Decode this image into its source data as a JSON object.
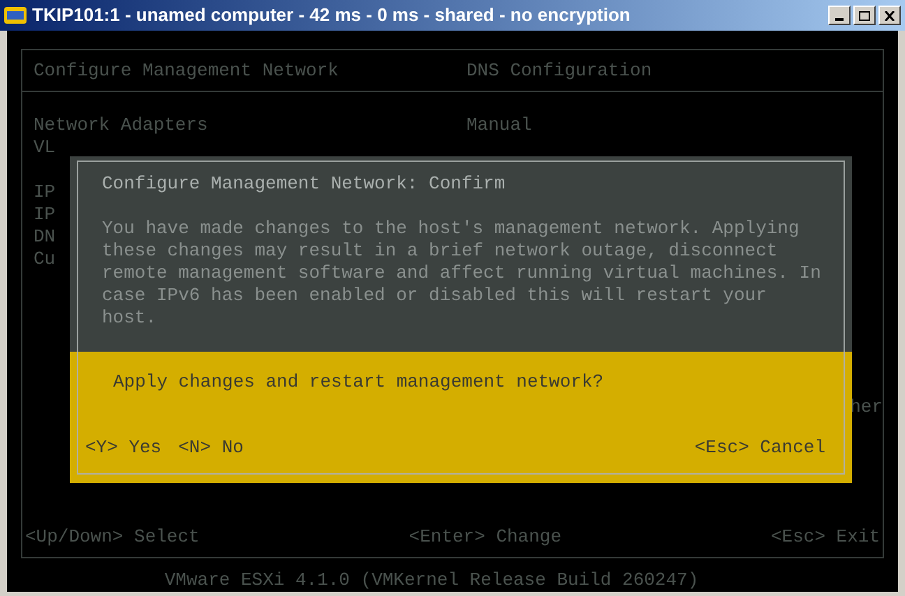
{
  "window": {
    "title": "TKIP101:1 - unamed computer - 42 ms - 0 ms - shared - no encryption"
  },
  "console": {
    "header": {
      "left": "Configure Management Network",
      "right": "DNS Configuration"
    },
    "rows": [
      {
        "label": "Network Adapters",
        "value": "Manual"
      },
      {
        "label": "VL",
        "value": ""
      },
      {
        "label": "",
        "value": ""
      },
      {
        "label": "IP",
        "value": ""
      },
      {
        "label": "IP",
        "value": ""
      },
      {
        "label": "DN",
        "value": ""
      },
      {
        "label": "Cu",
        "value": ""
      }
    ],
    "side_text": "her",
    "footer": [
      "<Up/Down> Select",
      "<Enter> Change",
      "<Esc> Exit"
    ],
    "version": "VMware ESXi 4.1.0 (VMKernel Release Build 260247)"
  },
  "dialog": {
    "title": "Configure Management Network: Confirm",
    "message": "You have made changes to the host's management network. Applying these changes may result in a brief network outage, disconnect remote management software and affect running virtual machines. In case IPv6 has been enabled or disabled this will restart your host.",
    "question": "Apply changes and restart management network?",
    "options": [
      {
        "key": "<Y>",
        "label": "Yes"
      },
      {
        "key": "<N>",
        "label": "No"
      }
    ],
    "cancel": {
      "key": "<Esc>",
      "label": "Cancel"
    }
  }
}
